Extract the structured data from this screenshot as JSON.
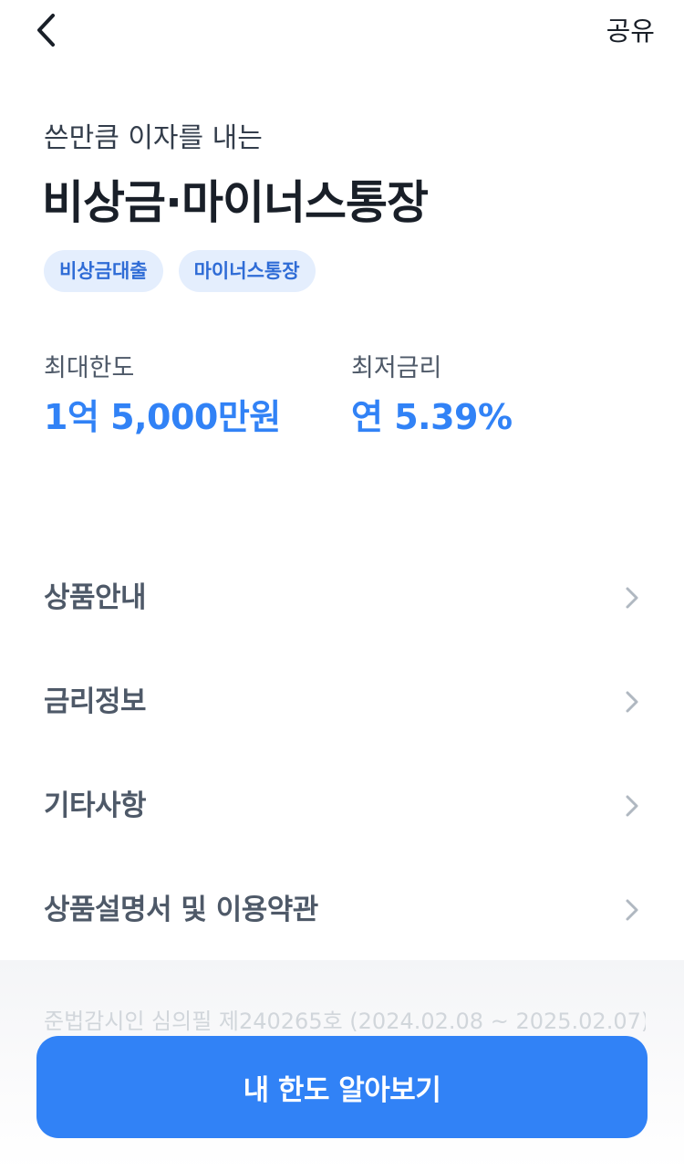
{
  "header": {
    "back_icon": "chevron-left-icon",
    "share_label": "공유"
  },
  "product": {
    "subtitle": "쓴만큼 이자를 내는",
    "title": "비상금·마이너스통장",
    "tags": [
      "비상금대출",
      "마이너스통장"
    ]
  },
  "stats": {
    "max_limit_label": "최대한도",
    "max_limit_value": "1억 5,000만원",
    "min_rate_label": "최저금리",
    "min_rate_value": "연 5.39%"
  },
  "menu": {
    "items": [
      {
        "label": "상품안내"
      },
      {
        "label": "금리정보"
      },
      {
        "label": "기타사항"
      },
      {
        "label": "상품설명서 및 이용약관"
      }
    ],
    "chevron_icon": "chevron-right-icon"
  },
  "footer": {
    "disclaimer": "준법감시인 심의필 제240265호 (2024.02.08 ~ 2025.02.07)",
    "cta_label": "내 한도 알아보기"
  },
  "colors": {
    "accent": "#3182f6",
    "tag_bg": "#e4eefd",
    "tag_text": "#2f6cd6",
    "text_primary": "#191f28",
    "text_secondary": "#4e5968"
  }
}
